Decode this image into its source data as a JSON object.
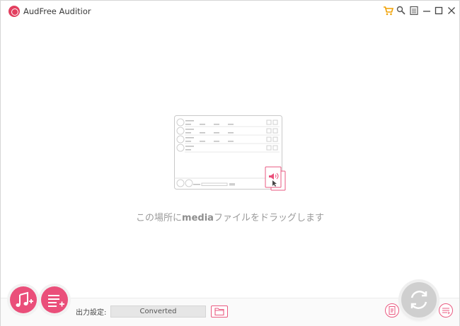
{
  "window": {
    "title": "AudFree Auditior",
    "controls": [
      "cart-icon",
      "search-key-icon",
      "menu-icon",
      "minimize-icon",
      "maximize-icon",
      "close-icon"
    ]
  },
  "drop_area": {
    "hint_before": "この場所に",
    "hint_bold": "media",
    "hint_after": "ファイルをドラッグします"
  },
  "bottom": {
    "add_music_icon": "music-note-add-icon",
    "add_playlist_icon": "playlist-add-icon",
    "output_label": "出力設定:",
    "output_path": "Converted",
    "folder_icon": "folder-icon",
    "format_icon": "format-settings-icon",
    "convert_icon": "convert-refresh-icon",
    "history_icon": "converted-list-icon"
  },
  "colors": {
    "accent": "#ea4f7a",
    "logo": "#e23f5f",
    "convert_disabled": "#cfcfcf"
  }
}
